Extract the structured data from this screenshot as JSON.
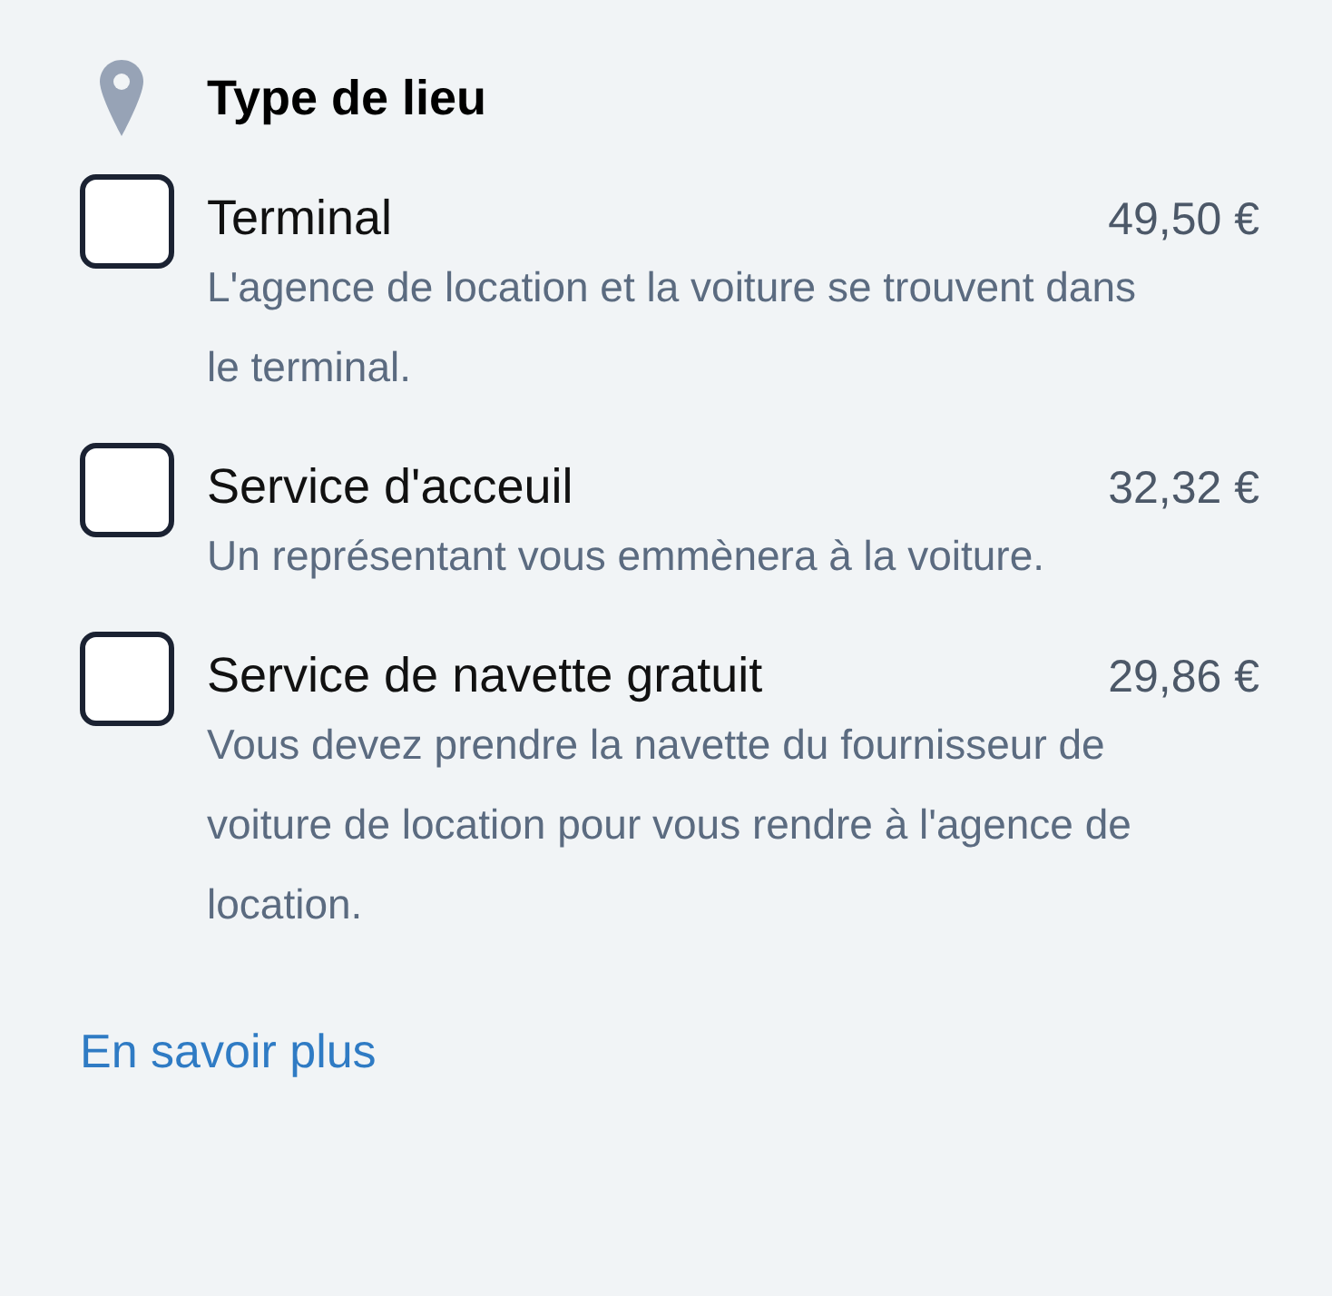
{
  "section": {
    "title": "Type de lieu"
  },
  "options": [
    {
      "name": "Terminal",
      "price": "49,50 €",
      "description": "L'agence de location et la voiture se trouvent dans le terminal.",
      "checked": false
    },
    {
      "name": "Service d'acceuil",
      "price": "32,32 €",
      "description": "Un représentant vous emmènera à la voiture.",
      "checked": false
    },
    {
      "name": "Service de navette gratuit",
      "price": "29,86 €",
      "description": "Vous devez prendre la navette du fournisseur de voiture de location pour vous rendre à l'agence de location.",
      "checked": false
    }
  ],
  "link": "En savoir plus"
}
